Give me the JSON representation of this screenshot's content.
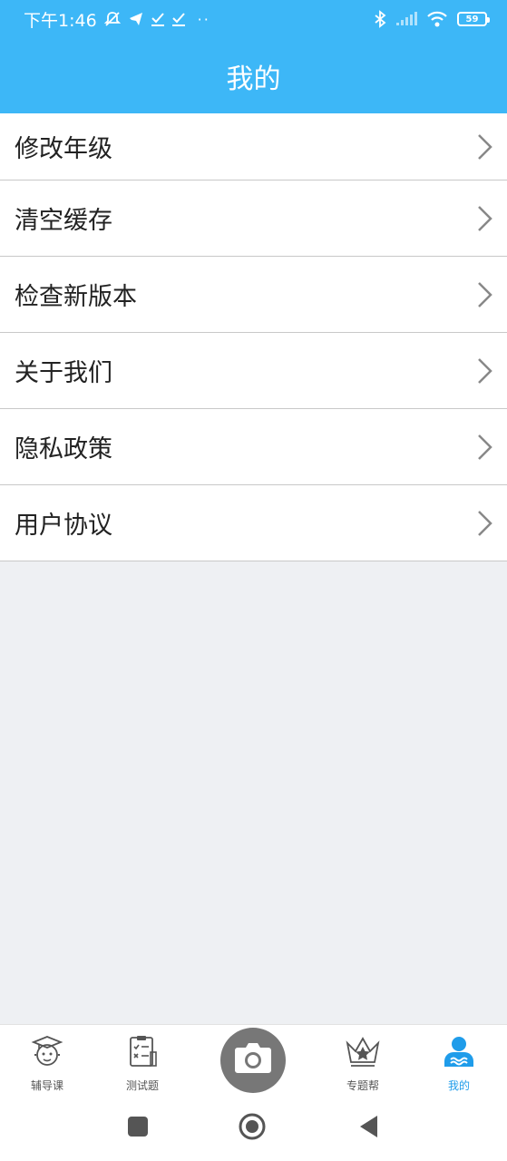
{
  "status_bar": {
    "time": "下午1:46",
    "battery": "59",
    "icons": [
      "mute-icon",
      "telegram-icon",
      "check-icon",
      "check-icon",
      "more-dots-icon",
      "bluetooth-icon",
      "signal-icon",
      "wifi-icon",
      "battery-icon"
    ]
  },
  "header": {
    "title": "我的"
  },
  "menu": {
    "items": [
      {
        "label": "修改年级"
      },
      {
        "label": "清空缓存"
      },
      {
        "label": "检查新版本"
      },
      {
        "label": "关于我们"
      },
      {
        "label": "隐私政策"
      },
      {
        "label": "用户协议"
      }
    ]
  },
  "tabs": {
    "items": [
      {
        "label": "辅导课",
        "icon": "tutor-icon"
      },
      {
        "label": "测试题",
        "icon": "quiz-icon"
      },
      {
        "label": "",
        "icon": "camera-icon"
      },
      {
        "label": "专题帮",
        "icon": "crown-icon"
      },
      {
        "label": "我的",
        "icon": "user-icon"
      }
    ],
    "active": "我的"
  },
  "colors": {
    "accent": "#3db7f7",
    "active_tab": "#1f9cea",
    "background": "#eef0f3"
  },
  "nav": {
    "icons": [
      "square-icon",
      "home-circle-icon",
      "back-triangle-icon"
    ]
  }
}
